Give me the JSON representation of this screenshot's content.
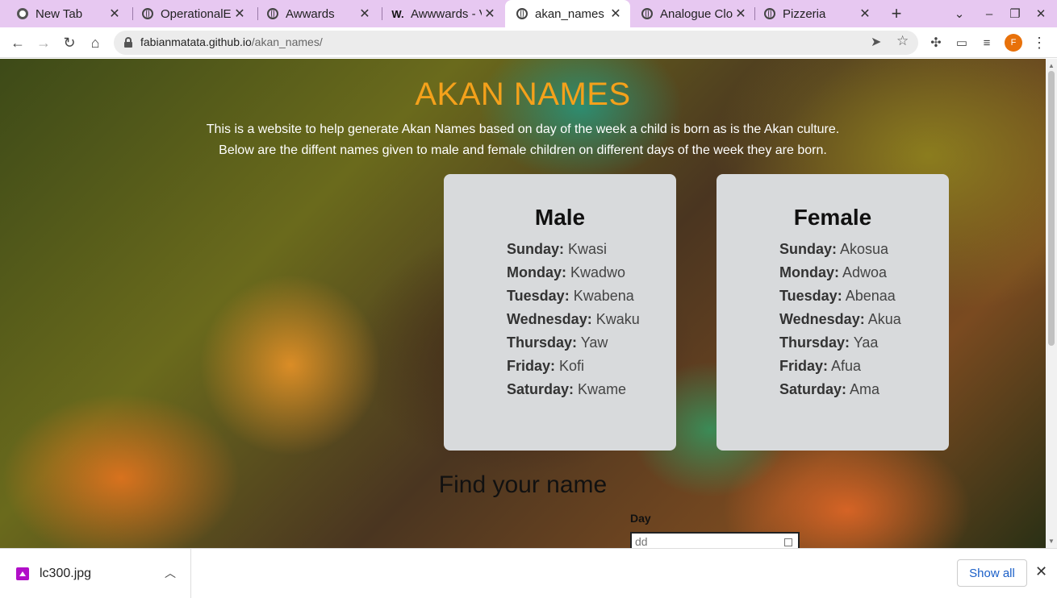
{
  "browser": {
    "tabs": [
      {
        "title": "New Tab",
        "icon": "chrome-icon"
      },
      {
        "title": "OperationalE",
        "icon": "globe-icon"
      },
      {
        "title": "Awwards",
        "icon": "globe-icon"
      },
      {
        "title": "Awwwards - V",
        "icon": "awwwards-icon",
        "logo": "W."
      },
      {
        "title": "akan_names",
        "icon": "globe-icon",
        "active": true
      },
      {
        "title": "Analogue Clo",
        "icon": "globe-icon"
      },
      {
        "title": "Pizzeria",
        "icon": "globe-icon"
      }
    ],
    "new_tab_symbol": "+",
    "url_host": "fabianmatata.github.io",
    "url_path": "/akan_names/",
    "profile_initial": "F"
  },
  "page": {
    "title": "AKAN NAMES",
    "intro_line1": "This is a website to help generate Akan Names based on day of the week a child is born as is the Akan culture.",
    "intro_line2": "Below are the diffent names given to male and female children on different days of the week they are born.",
    "male": {
      "heading": "Male",
      "names": [
        {
          "day": "Sunday:",
          "name": "Kwasi"
        },
        {
          "day": "Monday:",
          "name": "Kwadwo"
        },
        {
          "day": "Tuesday:",
          "name": "Kwabena"
        },
        {
          "day": "Wednesday:",
          "name": "Kwaku"
        },
        {
          "day": "Thursday:",
          "name": "Yaw"
        },
        {
          "day": "Friday:",
          "name": "Kofi"
        },
        {
          "day": "Saturday:",
          "name": "Kwame"
        }
      ]
    },
    "female": {
      "heading": "Female",
      "names": [
        {
          "day": "Sunday:",
          "name": "Akosua"
        },
        {
          "day": "Monday:",
          "name": "Adwoa"
        },
        {
          "day": "Tuesday:",
          "name": "Abenaa"
        },
        {
          "day": "Wednesday:",
          "name": "Akua"
        },
        {
          "day": "Thursday:",
          "name": "Yaa"
        },
        {
          "day": "Friday:",
          "name": "Afua"
        },
        {
          "day": "Saturday:",
          "name": "Ama"
        }
      ]
    },
    "find_heading": "Find your name",
    "day_label": "Day",
    "day_placeholder": "dd"
  },
  "downloads": {
    "file_name": "lc300.jpg",
    "show_all": "Show all"
  },
  "colors": {
    "title": "#f4a11b",
    "card_bg": "#d8dadc",
    "tabstrip_bg": "#e7c8f1",
    "show_all_text": "#1a5fc8"
  }
}
